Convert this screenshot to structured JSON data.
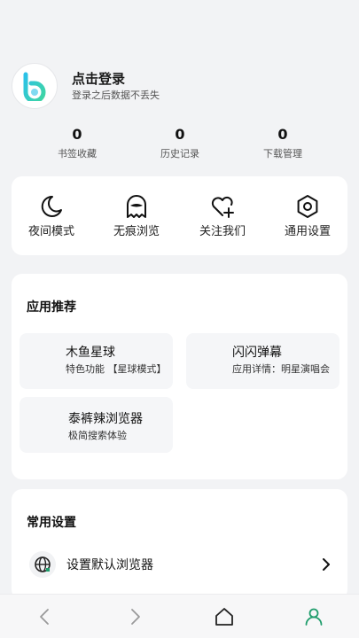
{
  "profile": {
    "title": "点击登录",
    "subtitle": "登录之后数据不丢失"
  },
  "stats": [
    {
      "value": "0",
      "label": "书签收藏"
    },
    {
      "value": "0",
      "label": "历史记录"
    },
    {
      "value": "0",
      "label": "下载管理"
    }
  ],
  "quick_actions": [
    {
      "label": "夜间模式",
      "icon": "moon-icon"
    },
    {
      "label": "无痕浏览",
      "icon": "ghost-icon"
    },
    {
      "label": "关注我们",
      "icon": "heart-plus-icon"
    },
    {
      "label": "通用设置",
      "icon": "hexagon-settings-icon"
    }
  ],
  "apps": {
    "title": "应用推荐",
    "items": [
      {
        "name": "木鱼星球",
        "desc": "特色功能 【星球模式】"
      },
      {
        "name": "闪闪弹幕",
        "desc": "应用详情：明星演唱会"
      },
      {
        "name": "泰裤辣浏览器",
        "desc": "极简搜索体验"
      }
    ]
  },
  "settings": {
    "title": "常用设置",
    "default_browser_label": "设置默认浏览器"
  },
  "colors": {
    "brand_gradient_start": "#2bc1e8",
    "brand_gradient_end": "#3fd6a0",
    "accent_green": "#1f9d6c",
    "page_bg": "#f2f3f5"
  },
  "nav": [
    "back-icon",
    "forward-icon",
    "home-icon",
    "profile-icon"
  ]
}
